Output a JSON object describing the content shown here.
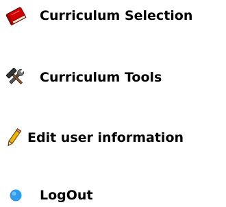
{
  "menu": {
    "items": [
      {
        "label": "Curriculum Selection",
        "icon": "book-icon"
      },
      {
        "label": "Curriculum Tools",
        "icon": "hammer-wrench-icon"
      },
      {
        "label": "Edit user information",
        "icon": "pencil-icon"
      },
      {
        "label": "LogOut",
        "icon": "blue-dot-icon"
      }
    ]
  },
  "colors": {
    "book": "#d40000",
    "pencil": "#f2b300",
    "logout_dot": "#2b9cf0",
    "text": "#000000"
  }
}
